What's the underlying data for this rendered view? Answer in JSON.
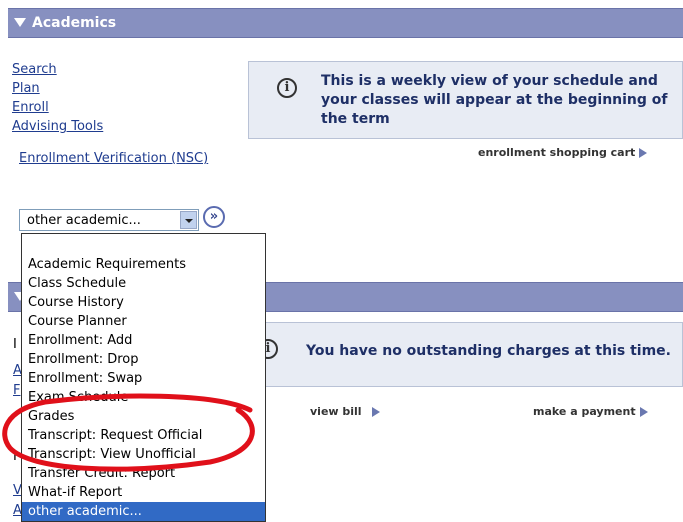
{
  "academics": {
    "title": "Academics",
    "links": [
      "Search",
      "Plan",
      "Enroll",
      "Advising Tools"
    ],
    "nsc_link": "Enrollment Verification (NSC)",
    "info": "This is a weekly view of your schedule and your classes will appear at the beginning of the term",
    "shopping_cart": "enrollment shopping cart",
    "select_value": "other academic...",
    "dropdown_options": [
      "Academic Requirements",
      "Class Schedule",
      "Course History",
      "Course Planner",
      "Enrollment: Add",
      "Enrollment: Drop",
      "Enrollment: Swap",
      "Exam Schedule",
      "Grades",
      "Transcript: Request Official",
      "Transcript: View Unofficial",
      "Transfer Credit: Report",
      "What-if Report",
      "other academic..."
    ],
    "selected_option": "other academic..."
  },
  "finances": {
    "info": "You have no outstanding charges at this time.",
    "view_bill": "view bill",
    "make_payment": "make a payment"
  },
  "colors": {
    "header_bg": "#8790c0",
    "info_bg": "#e8ecf4",
    "link": "#1f3c8f",
    "selected": "#316ac5",
    "annotation": "#e0101a"
  }
}
